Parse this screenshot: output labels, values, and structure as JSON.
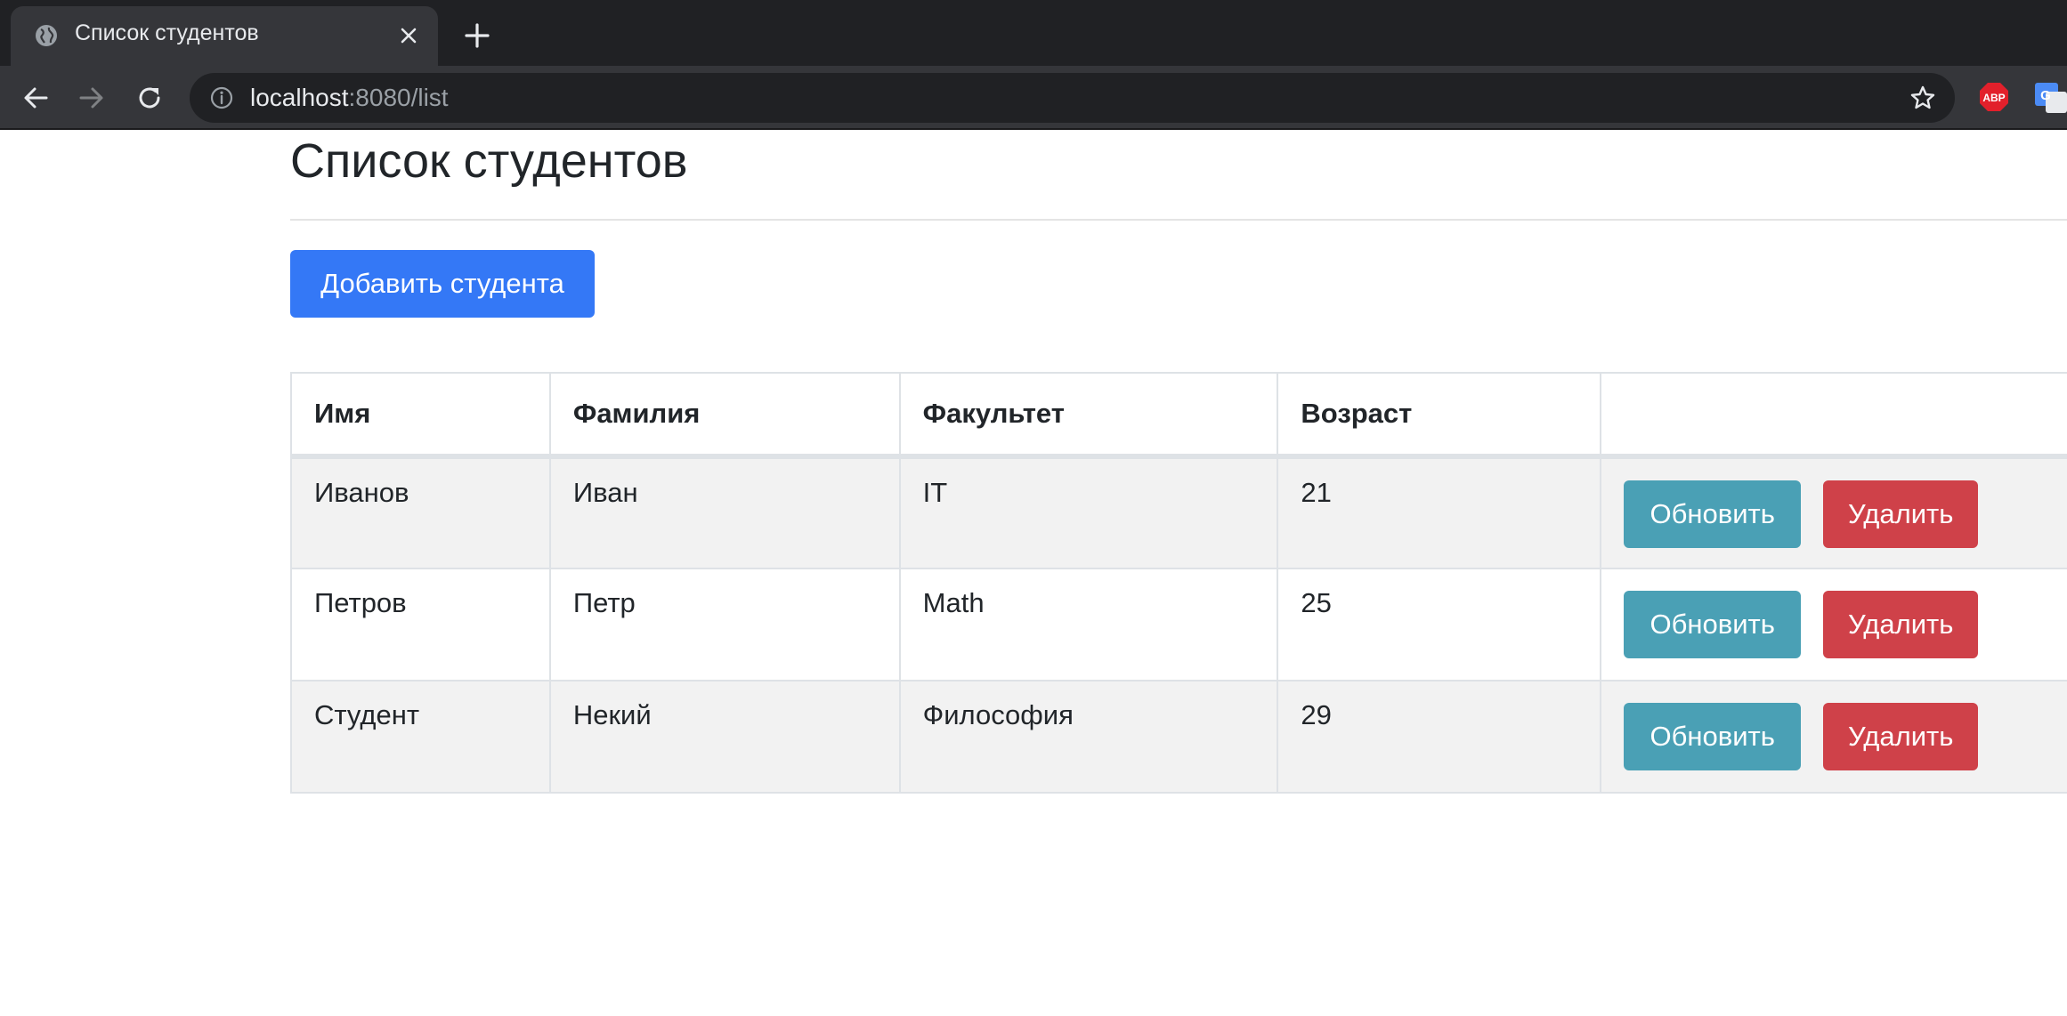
{
  "browser": {
    "tab_title": "Список студентов",
    "url_host": "localhost",
    "url_rest": ":8080/list",
    "extension_abp_label": "ABP",
    "extension_translate_label": "G"
  },
  "page": {
    "title": "Список студентов",
    "add_button_label": "Добавить студента"
  },
  "table": {
    "headers": [
      "Имя",
      "Фамилия",
      "Факультет",
      "Возраст",
      ""
    ],
    "rows": [
      {
        "name": "Иванов",
        "surname": "Иван",
        "faculty": "IT",
        "age": "21",
        "update_label": "Обновить",
        "delete_label": "Удалить"
      },
      {
        "name": "Петров",
        "surname": "Петр",
        "faculty": "Math",
        "age": "25",
        "update_label": "Обновить",
        "delete_label": "Удалить"
      },
      {
        "name": "Студент",
        "surname": "Некий",
        "faculty": "Философия",
        "age": "29",
        "update_label": "Обновить",
        "delete_label": "Удалить"
      }
    ]
  },
  "colors": {
    "primary_button": "#3478f6",
    "update_button": "#4aa0b5",
    "delete_button": "#cf4149",
    "striped_row": "#f2f2f2"
  },
  "icons": [
    "globe-icon",
    "close-icon",
    "plus-icon",
    "back-arrow-icon",
    "forward-arrow-icon",
    "reload-icon",
    "info-icon",
    "star-icon",
    "adblock-icon",
    "translate-icon"
  ]
}
